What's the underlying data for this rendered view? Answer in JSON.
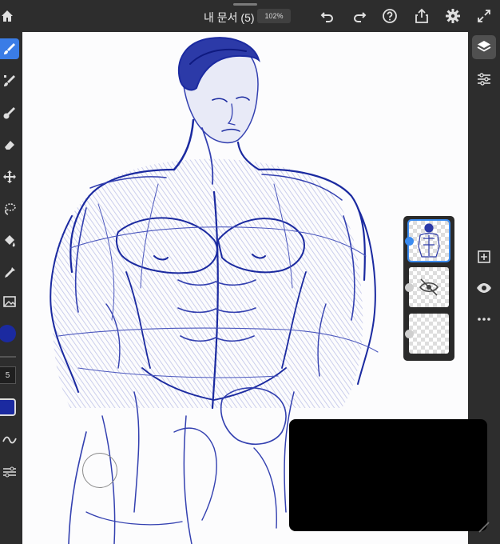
{
  "header": {
    "doc_title": "내 문서 (5)",
    "zoom": "102%",
    "icons": [
      "home-icon",
      "undo-icon",
      "redo-icon",
      "help-icon",
      "share-icon",
      "settings-icon",
      "expand-icon"
    ]
  },
  "left_toolbar": {
    "tools": [
      "brush-tool",
      "pixel-brush-tool",
      "live-brush-tool",
      "eraser-tool",
      "move-tool",
      "lasso-tool",
      "fill-tool",
      "eyedropper-tool",
      "image-tool"
    ],
    "brush_size": "5",
    "color": "#1b2aa0"
  },
  "right_toolbar": {
    "icons": [
      "layers-icon",
      "properties-icon",
      "add-layer-icon",
      "visibility-icon",
      "more-icon"
    ]
  },
  "layers": {
    "count": 3,
    "selected_index": 0
  },
  "colors": {
    "accent": "#3a7ce6",
    "ink": "#1b2aa0",
    "toolbar": "#2d2d2d"
  }
}
